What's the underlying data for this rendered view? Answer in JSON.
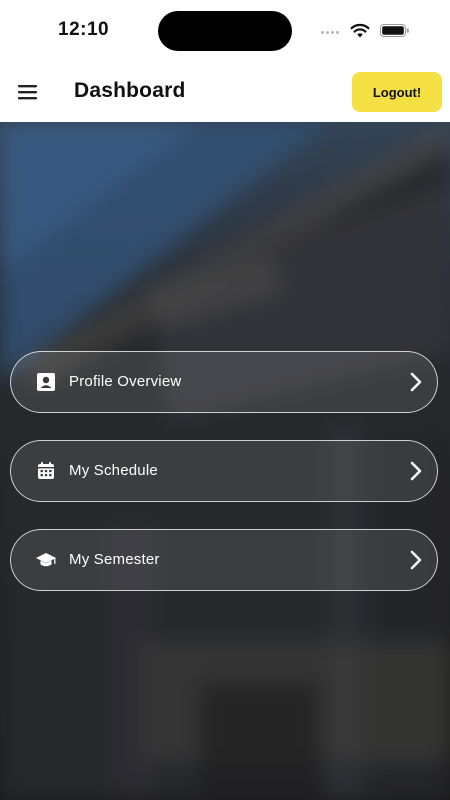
{
  "status_bar": {
    "time": "12:10",
    "icons": [
      "signal-dots-icon",
      "wifi-icon",
      "battery-icon"
    ]
  },
  "nav": {
    "title": "Dashboard",
    "menu_icon": "hamburger-menu-icon",
    "logout_label": "Logout!"
  },
  "menu": {
    "items": [
      {
        "label": "Profile Overview",
        "icon": "profile-card-icon"
      },
      {
        "label": "My Schedule",
        "icon": "calendar-icon"
      },
      {
        "label": "My Semester",
        "icon": "graduation-cap-icon"
      }
    ]
  },
  "colors": {
    "accent": "#f5e043",
    "card_border": "#ffffff",
    "text_on_dark": "#ffffff"
  }
}
